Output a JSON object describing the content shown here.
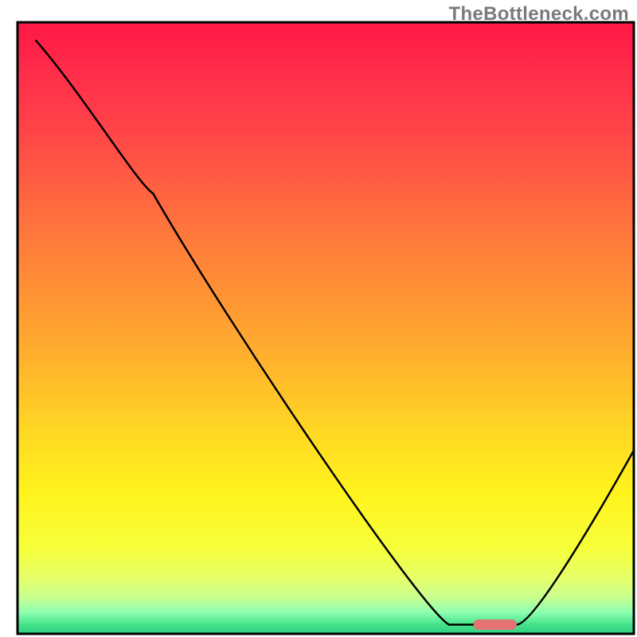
{
  "watermark": "TheBottleneck.com",
  "chart_data": {
    "type": "line",
    "title": "",
    "xlabel": "",
    "ylabel": "",
    "xlim": [
      0,
      1
    ],
    "ylim": [
      0,
      1
    ],
    "x": [
      0.03,
      0.22,
      0.7,
      0.74,
      0.81,
      1.0
    ],
    "values": [
      0.97,
      0.72,
      0.015,
      0.015,
      0.015,
      0.3
    ],
    "marker": {
      "x_start": 0.74,
      "x_end": 0.81,
      "y": 0.015,
      "color": "#e57373"
    },
    "background_gradient": {
      "stops": [
        {
          "offset": 0.0,
          "color": "#ff1744"
        },
        {
          "offset": 0.07,
          "color": "#ff2a4a"
        },
        {
          "offset": 0.18,
          "color": "#ff4548"
        },
        {
          "offset": 0.3,
          "color": "#ff6a3f"
        },
        {
          "offset": 0.42,
          "color": "#ff8c36"
        },
        {
          "offset": 0.55,
          "color": "#ffb12d"
        },
        {
          "offset": 0.66,
          "color": "#ffd524"
        },
        {
          "offset": 0.77,
          "color": "#fff31c"
        },
        {
          "offset": 0.86,
          "color": "#f7ff3a"
        },
        {
          "offset": 0.91,
          "color": "#e4ff6a"
        },
        {
          "offset": 0.94,
          "color": "#c9ff8f"
        },
        {
          "offset": 0.965,
          "color": "#8dffb0"
        },
        {
          "offset": 0.985,
          "color": "#46e28a"
        },
        {
          "offset": 1.0,
          "color": "#2fd082"
        }
      ]
    },
    "frame_color": "#000000",
    "line_color": "#000000",
    "line_width": 2.5
  }
}
